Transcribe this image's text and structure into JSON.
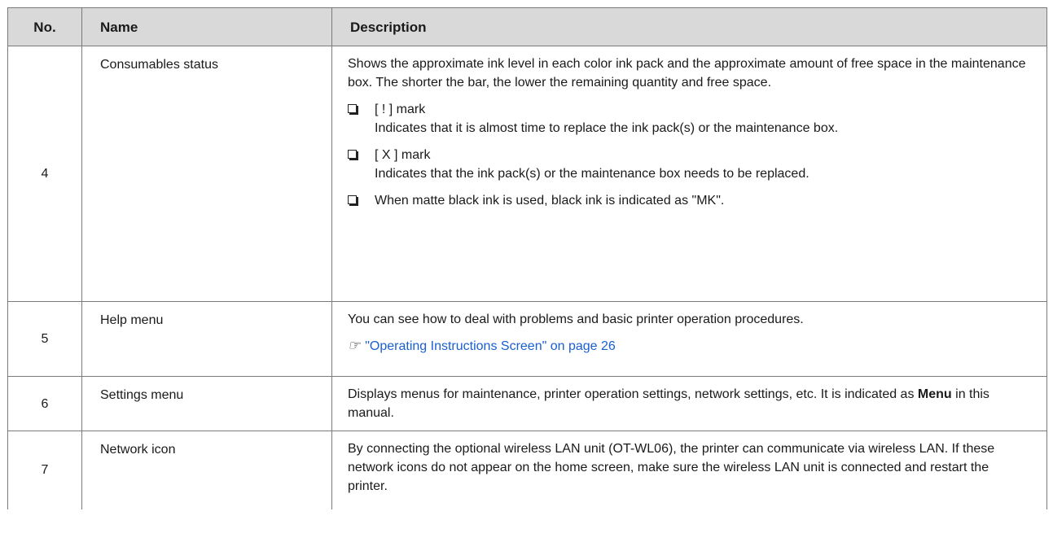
{
  "header": {
    "no": "No.",
    "name": "Name",
    "description": "Description"
  },
  "rows": [
    {
      "no": "4",
      "name": "Consumables status",
      "intro": "Shows the approximate ink level in each color ink pack and the approximate amount of free space in the maintenance box. The shorter the bar, the lower the remaining quantity and free space.",
      "bullets": [
        {
          "title": "[ ! ] mark",
          "text": "Indicates that it is almost time to replace the ink pack(s) or the maintenance box."
        },
        {
          "title": "[ X ] mark",
          "text": "Indicates that the ink pack(s) or the maintenance box needs to be replaced."
        },
        {
          "title": "When matte black ink is used, black ink is indicated as \"MK\".",
          "text": ""
        }
      ]
    },
    {
      "no": "5",
      "name": "Help menu",
      "text": "You can see how to deal with problems and basic printer operation procedures.",
      "link_icon": "reference-arrow-icon",
      "link_text": "\"Operating Instructions Screen\" on page 26"
    },
    {
      "no": "6",
      "name": "Settings menu",
      "text_before": "Displays menus for maintenance, printer operation settings, network settings, etc. It is indicated as ",
      "bold": "Menu",
      "text_after": " in this manual."
    },
    {
      "no": "7",
      "name": "Network icon",
      "text": "By connecting the optional wireless LAN unit (OT-WL06), the printer can communicate via wireless LAN. If these network icons do not appear on the home screen, make sure the wireless LAN unit is connected and restart the printer."
    }
  ],
  "colors": {
    "header_bg": "#d9d9d9",
    "border": "#7a7a7a",
    "link": "#1a5fd0"
  }
}
